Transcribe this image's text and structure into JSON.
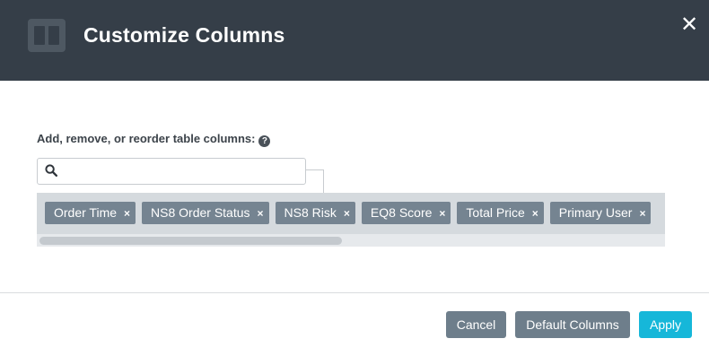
{
  "header": {
    "title": "Customize Columns",
    "icon": "columns-icon",
    "close_icon": "close-icon",
    "close_glyph": "✕"
  },
  "instructions": {
    "label": "Add, remove, or reorder table columns:",
    "help_icon": "question-circle-icon",
    "help_glyph": "?"
  },
  "search": {
    "value": "",
    "placeholder": "",
    "icon": "search-icon"
  },
  "columns": [
    {
      "label": "Order Time",
      "remove": "×"
    },
    {
      "label": "NS8 Order Status",
      "remove": "×"
    },
    {
      "label": "NS8 Risk",
      "remove": "×"
    },
    {
      "label": "EQ8 Score",
      "remove": "×"
    },
    {
      "label": "Total Price",
      "remove": "×"
    },
    {
      "label": "Primary User",
      "remove": "×"
    }
  ],
  "footer": {
    "cancel_label": "Cancel",
    "default_label": "Default Columns",
    "apply_label": "Apply"
  },
  "colors": {
    "header_bg": "#353e48",
    "chip_bg": "#758491",
    "apply_bg": "#16b7d9",
    "secondary_btn_bg": "#6e7e8b"
  }
}
